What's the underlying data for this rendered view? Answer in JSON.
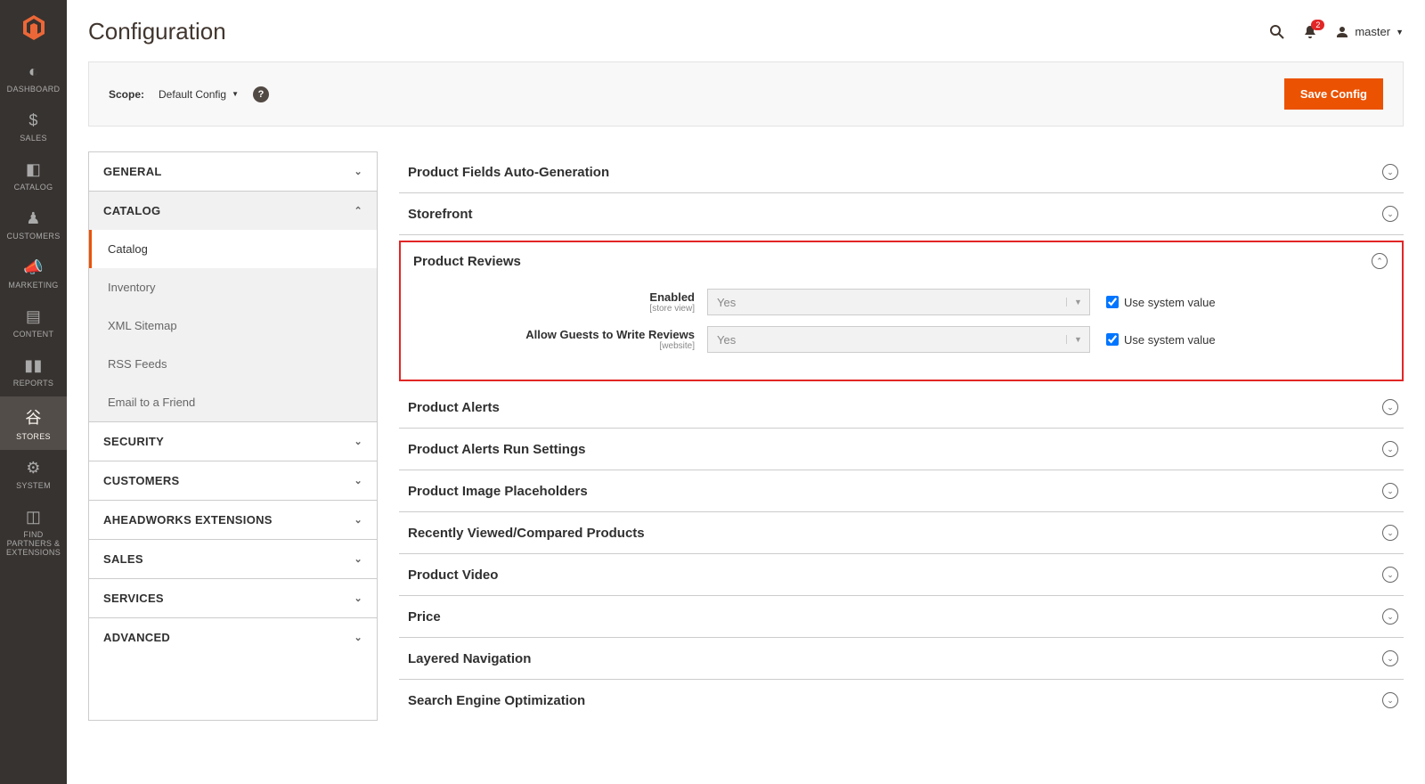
{
  "page": {
    "title": "Configuration"
  },
  "topbar": {
    "notif_count": "2",
    "user_name": "master"
  },
  "scope": {
    "label": "Scope:",
    "value": "Default Config",
    "save_button": "Save Config"
  },
  "sidebar": [
    {
      "key": "dashboard",
      "label": "DASHBOARD"
    },
    {
      "key": "sales",
      "label": "SALES"
    },
    {
      "key": "catalog",
      "label": "CATALOG"
    },
    {
      "key": "customers",
      "label": "CUSTOMERS"
    },
    {
      "key": "marketing",
      "label": "MARKETING"
    },
    {
      "key": "content",
      "label": "CONTENT"
    },
    {
      "key": "reports",
      "label": "REPORTS"
    },
    {
      "key": "stores",
      "label": "STORES",
      "active": true
    },
    {
      "key": "system",
      "label": "SYSTEM"
    },
    {
      "key": "partners",
      "label": "FIND PARTNERS & EXTENSIONS"
    }
  ],
  "config_nav": [
    {
      "label": "GENERAL",
      "expanded": false
    },
    {
      "label": "CATALOG",
      "expanded": true,
      "items": [
        {
          "label": "Catalog",
          "active": true
        },
        {
          "label": "Inventory"
        },
        {
          "label": "XML Sitemap"
        },
        {
          "label": "RSS Feeds"
        },
        {
          "label": "Email to a Friend"
        }
      ]
    },
    {
      "label": "SECURITY"
    },
    {
      "label": "CUSTOMERS"
    },
    {
      "label": "AHEADWORKS EXTENSIONS"
    },
    {
      "label": "SALES"
    },
    {
      "label": "SERVICES"
    },
    {
      "label": "ADVANCED"
    }
  ],
  "sections": {
    "s0": "Product Fields Auto-Generation",
    "s1": "Storefront",
    "s2": "Product Reviews",
    "s3": "Product Alerts",
    "s4": "Product Alerts Run Settings",
    "s5": "Product Image Placeholders",
    "s6": "Recently Viewed/Compared Products",
    "s7": "Product Video",
    "s8": "Price",
    "s9": "Layered Navigation",
    "s10": "Search Engine Optimization"
  },
  "reviews": {
    "fields": [
      {
        "label": "Enabled",
        "scope": "[store view]",
        "value": "Yes",
        "use_system": true
      },
      {
        "label": "Allow Guests to Write Reviews",
        "scope": "[website]",
        "value": "Yes",
        "use_system": true
      }
    ],
    "use_system_label": "Use system value"
  }
}
